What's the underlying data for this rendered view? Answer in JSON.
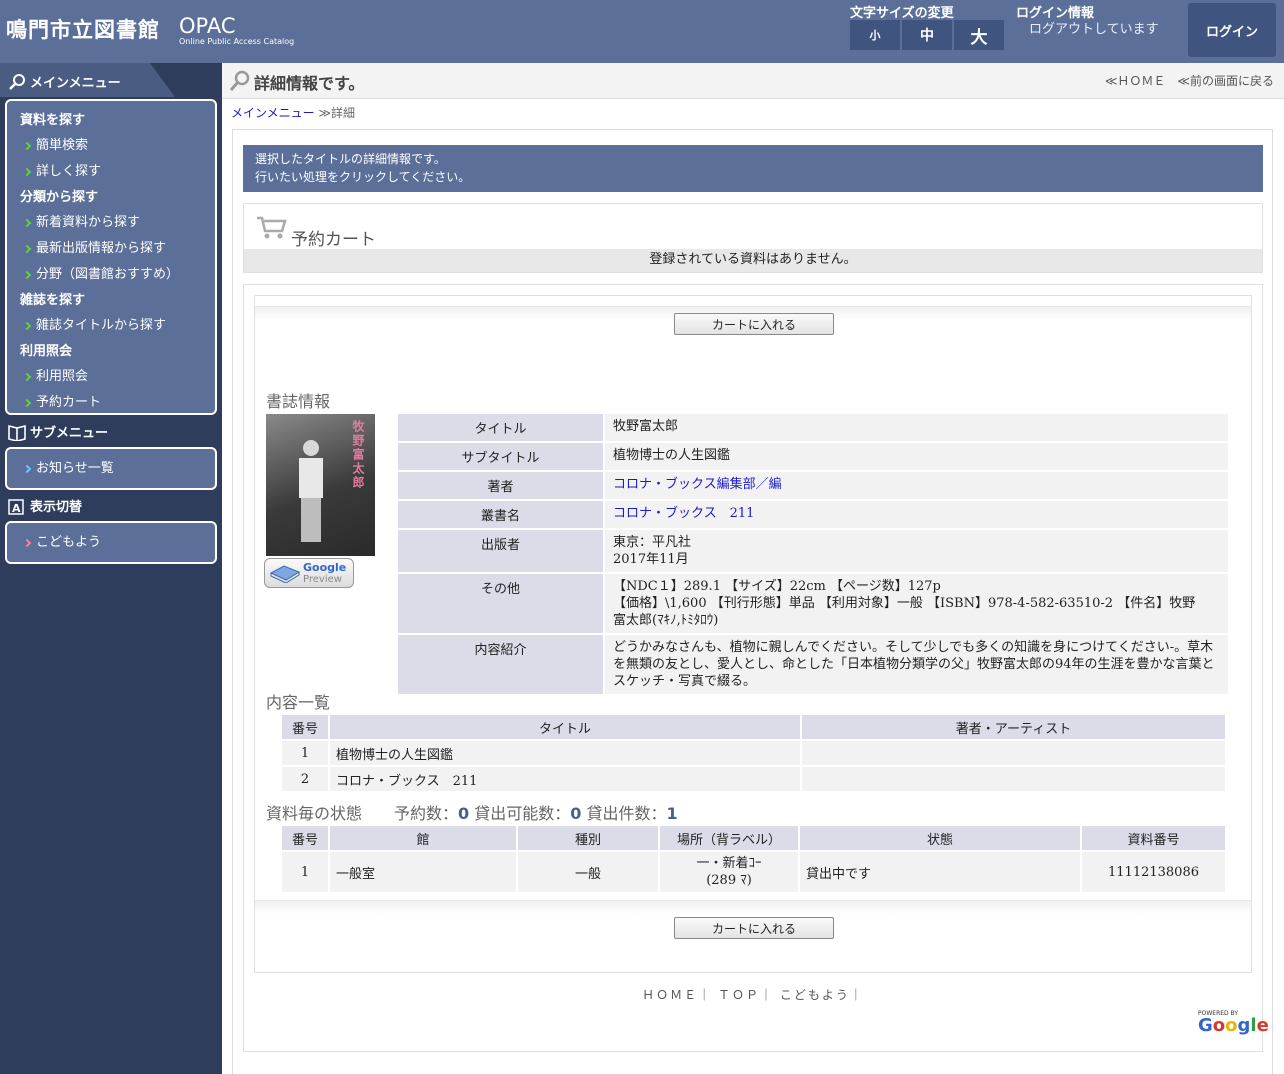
{
  "header": {
    "site_title": "鳴門市立図書館",
    "opac_big": "OPAC",
    "opac_small": "Online Public Access Catalog",
    "font_size_label": "文字サイズの変更",
    "font_small": "小",
    "font_medium": "中",
    "font_large": "大",
    "login_info_label": "ログイン情報",
    "login_info_value": "ログアウトしています",
    "login_button": "ログイン"
  },
  "sidebar": {
    "main_menu": "メインメニュー",
    "groups": [
      {
        "label": "資料を探す",
        "items": [
          "簡単検索",
          "詳しく探す"
        ]
      },
      {
        "label": "分類から探す",
        "items": [
          "新着資料から探す",
          "最新出版情報から探す",
          "分野（図書館おすすめ）"
        ]
      },
      {
        "label": "雑誌を探す",
        "items": [
          "雑誌タイトルから探す"
        ]
      },
      {
        "label": "利用照会",
        "items": [
          "利用照会",
          "予約カート"
        ]
      }
    ],
    "sub_menu": "サブメニュー",
    "sub_items": [
      "お知らせ一覧"
    ],
    "display_switch": "表示切替",
    "display_items": [
      "こどもよう"
    ]
  },
  "main": {
    "page_title": "詳細情報です。",
    "home_link": "≪ＨＯＭＥ",
    "back_link": "≪前の画面に戻る",
    "breadcrumb_root": "メインメニュー",
    "breadcrumb_sep": "≫",
    "breadcrumb_current": "詳細",
    "banner_line1": "選択したタイトルの詳細情報です。",
    "banner_line2": "行いたい処理をクリックしてください。",
    "cart_title": "予約カート",
    "cart_empty": "登録されている資料はありません。",
    "add_to_cart": "カートに入れる"
  },
  "book": {
    "cover_title": "牧野富太郎",
    "preview_line1": "Google",
    "preview_line2": "Preview",
    "section_title": "書誌情報",
    "fields": [
      {
        "label": "タイトル",
        "value": "牧野富太郎",
        "link": false
      },
      {
        "label": "サブタイトル",
        "value": "植物博士の人生図鑑",
        "link": false
      },
      {
        "label": "著者",
        "value": "コロナ・ブックス編集部／編",
        "link": true
      },
      {
        "label": "叢書名",
        "value": "コロナ・ブックス　211",
        "link": true
      },
      {
        "label": "出版者",
        "value": "東京：平凡社",
        "value2": "2017年11月",
        "link": false
      },
      {
        "label": "その他",
        "value": "【NDC１】289.1 【サイズ】22cm 【ページ数】127p",
        "value2": "【価格】\\1,600 【刊行形態】単品 【利用対象】一般 【ISBN】978-4-582-63510-2 【件名】牧野　富太郎(ﾏｷﾉ,ﾄﾐﾀﾛｳ)",
        "link": false
      },
      {
        "label": "内容紹介",
        "value": "どうかみなさんも、植物に親しんでください。そして少しでも多くの知識を身につけてください-。草木を無類の友とし、愛人とし、命とした「日本植物分類学の父」牧野富太郎の94年の生涯を豊かな言葉とスケッチ・写真で綴る。",
        "link": false
      }
    ]
  },
  "contents": {
    "section_title": "内容一覧",
    "headers": [
      "番号",
      "タイトル",
      "著者・アーティスト"
    ],
    "rows": [
      [
        "1",
        "植物博士の人生図鑑",
        ""
      ],
      [
        "2",
        "コロナ・ブックス　211",
        ""
      ]
    ]
  },
  "status": {
    "section_title": "資料毎の状態",
    "reserve_label": "予約数：",
    "reserve_count": "0",
    "available_label": "貸出可能数：",
    "available_count": "0",
    "loan_label": "貸出件数：",
    "loan_count": "1",
    "headers": [
      "番号",
      "館",
      "種別",
      "場所（背ラベル）",
      "状態",
      "資料番号"
    ],
    "rows": [
      [
        "1",
        "一般室",
        "一般",
        "一・新着ｺｰ",
        "(289 ﾏ)",
        "貸出中です",
        "11112138086"
      ]
    ]
  },
  "footer": {
    "links": [
      "ＨＯＭＥ",
      "ＴＯＰ",
      "こどもよう"
    ],
    "powered_by": "POWERED BY",
    "google": "Google"
  }
}
